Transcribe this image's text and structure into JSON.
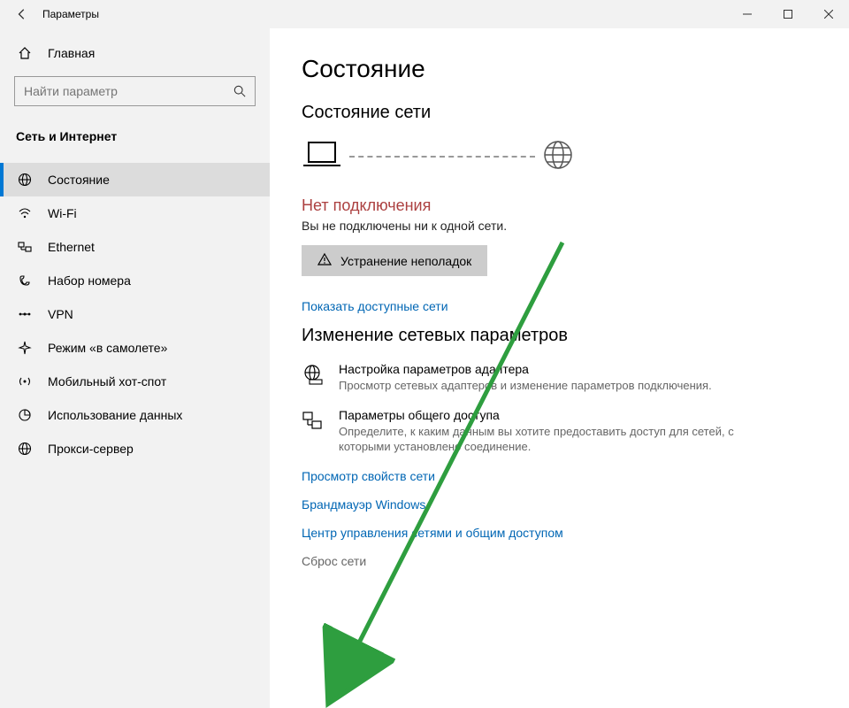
{
  "titlebar": {
    "title": "Параметры"
  },
  "sidebar": {
    "home_label": "Главная",
    "search_placeholder": "Найти параметр",
    "section_label": "Сеть и Интернет",
    "items": [
      {
        "label": "Состояние"
      },
      {
        "label": "Wi-Fi"
      },
      {
        "label": "Ethernet"
      },
      {
        "label": "Набор номера"
      },
      {
        "label": "VPN"
      },
      {
        "label": "Режим «в самолете»"
      },
      {
        "label": "Мобильный хот-спот"
      },
      {
        "label": "Использование данных"
      },
      {
        "label": "Прокси-сервер"
      }
    ]
  },
  "main": {
    "page_title": "Состояние",
    "status_heading": "Состояние сети",
    "error_title": "Нет подключения",
    "error_subtitle": "Вы не подключены ни к одной сети.",
    "troubleshoot_label": "Устранение неполадок",
    "show_networks_link": "Показать доступные сети",
    "change_heading": "Изменение сетевых параметров",
    "options": [
      {
        "title": "Настройка параметров адаптера",
        "desc": "Просмотр сетевых адаптеров и изменение параметров подключения."
      },
      {
        "title": "Параметры общего доступа",
        "desc": "Определите, к каким данным вы хотите предоставить доступ для сетей, с которыми установлено соединение."
      }
    ],
    "links": [
      "Просмотр свойств сети",
      "Брандмауэр Windows",
      "Центр управления сетями и общим доступом"
    ],
    "reset_label": "Сброс сети"
  }
}
